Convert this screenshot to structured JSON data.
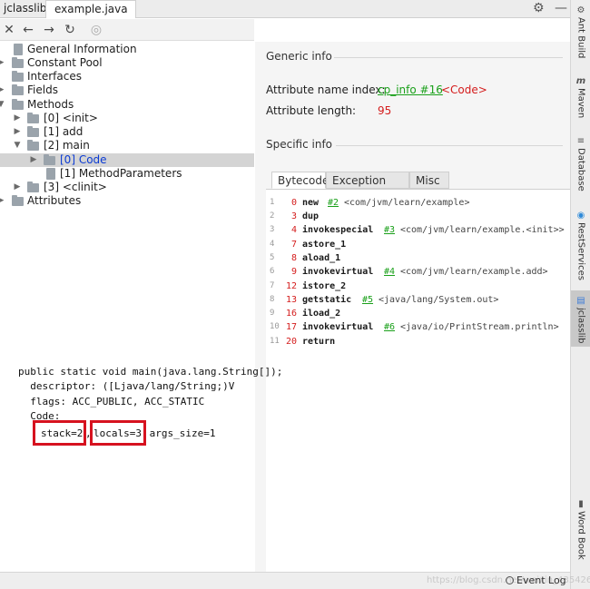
{
  "header": {
    "plugin_tab": "jclasslib:",
    "file_tab": "example.java",
    "close_glyph": "✕",
    "gear_icon": "gear-icon",
    "minimize_icon": "minimize-icon"
  },
  "toolbar": {
    "buttons": [
      {
        "icon": "close-icon",
        "glyph": "✕"
      },
      {
        "icon": "back-icon",
        "glyph": "←"
      },
      {
        "icon": "forward-icon",
        "glyph": "→"
      },
      {
        "icon": "refresh-icon",
        "glyph": "↻"
      },
      {
        "icon": "browser-icon",
        "glyph": "◎"
      }
    ]
  },
  "tree": {
    "items": [
      {
        "label": "General Information"
      },
      {
        "label": "Constant Pool"
      },
      {
        "label": "Interfaces"
      },
      {
        "label": "Fields"
      },
      {
        "label": "Methods"
      },
      {
        "label": "[0] <init>"
      },
      {
        "label": "[1] add"
      },
      {
        "label": "[2] main"
      },
      {
        "label": "[0] Code"
      },
      {
        "label": "[1] MethodParameters"
      },
      {
        "label": "[3] <clinit>"
      },
      {
        "label": "Attributes"
      }
    ]
  },
  "detail": {
    "generic_title": "Generic info",
    "attr_name_label": "Attribute name index:",
    "attr_name_link": "cp_info #16",
    "attr_name_value": "<Code>",
    "attr_length_label": "Attribute length:",
    "attr_length_value": "95",
    "specific_title": "Specific info",
    "tabs": [
      "Bytecode",
      "Exception table",
      "Misc"
    ],
    "active_tab": "Bytecode"
  },
  "bytecode": [
    {
      "line": "1",
      "offset": "0",
      "op": "new",
      "arg": "#2",
      "comment": "<com/jvm/learn/example>"
    },
    {
      "line": "2",
      "offset": "3",
      "op": "dup",
      "arg": "",
      "comment": ""
    },
    {
      "line": "3",
      "offset": "4",
      "op": "invokespecial",
      "arg": "#3",
      "comment": "<com/jvm/learn/example.<init>>"
    },
    {
      "line": "4",
      "offset": "7",
      "op": "astore_1",
      "arg": "",
      "comment": ""
    },
    {
      "line": "5",
      "offset": "8",
      "op": "aload_1",
      "arg": "",
      "comment": ""
    },
    {
      "line": "6",
      "offset": "9",
      "op": "invokevirtual",
      "arg": "#4",
      "comment": "<com/jvm/learn/example.add>"
    },
    {
      "line": "7",
      "offset": "12",
      "op": "istore_2",
      "arg": "",
      "comment": ""
    },
    {
      "line": "8",
      "offset": "13",
      "op": "getstatic",
      "arg": "#5",
      "comment": "<java/lang/System.out>"
    },
    {
      "line": "9",
      "offset": "16",
      "op": "iload_2",
      "arg": "",
      "comment": ""
    },
    {
      "line": "10",
      "offset": "17",
      "op": "invokevirtual",
      "arg": "#6",
      "comment": "<java/io/PrintStream.println>"
    },
    {
      "line": "11",
      "offset": "20",
      "op": "return",
      "arg": "",
      "comment": ""
    }
  ],
  "side_tools": [
    {
      "label": "Ant Build",
      "icon": "ant-icon",
      "glyph": "⚙"
    },
    {
      "label": "Maven",
      "icon": "maven-icon",
      "glyph": "m"
    },
    {
      "label": "Database",
      "icon": "database-icon",
      "glyph": "≡"
    },
    {
      "label": "RestServices",
      "icon": "rest-icon",
      "glyph": "◉"
    },
    {
      "label": "jclasslib",
      "icon": "jclasslib-icon",
      "glyph": "▤"
    },
    {
      "label": "Word Book",
      "icon": "book-icon",
      "glyph": "▮"
    }
  ],
  "javap": {
    "line1": "public static void main(java.lang.String[]);",
    "line2": "  descriptor: ([Ljava/lang/String;)V",
    "line3": "  flags: ACC_PUBLIC, ACC_STATIC",
    "line4": "  Code:",
    "stack": "stack=2",
    "sep1": ", ",
    "locals": "locals=3,",
    "args": " args_size=1",
    "highlight_color": "#d6121f"
  },
  "status": {
    "event_log": "Event Log",
    "watermark": "https://blog.csdn.net/weixin_43542636"
  }
}
